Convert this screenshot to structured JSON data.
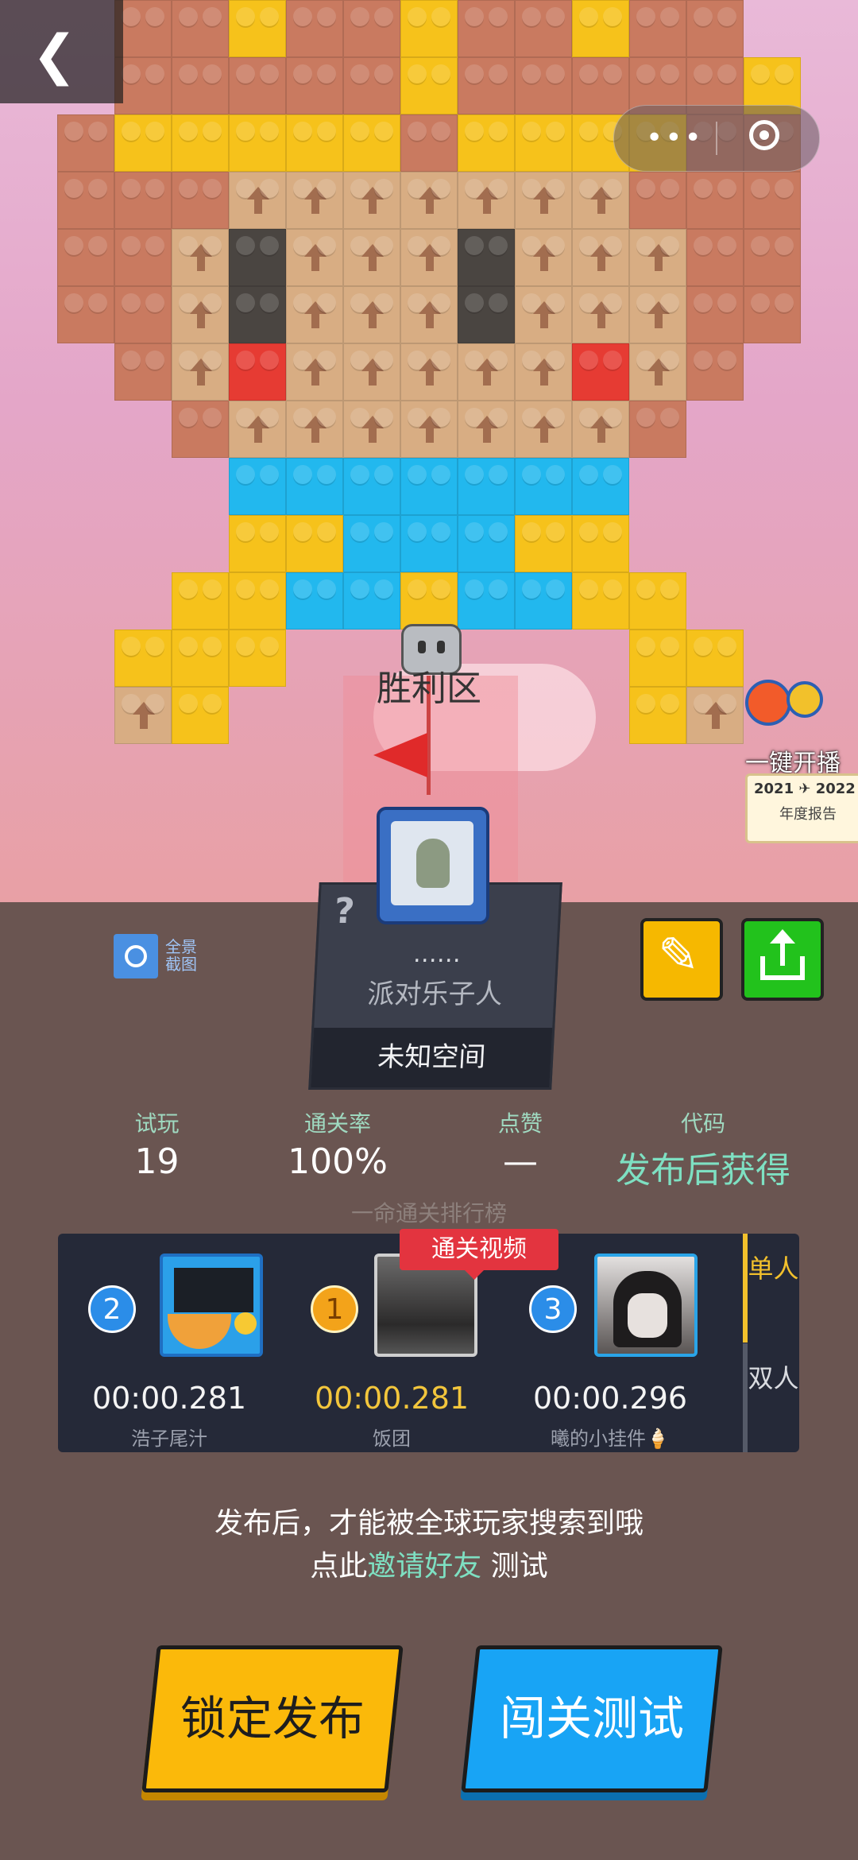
{
  "header": {
    "back_icon": "chevron-left-icon",
    "capsule_more_icon": "more-dots-icon",
    "capsule_close_icon": "target-close-icon"
  },
  "scene": {
    "victory_label": "胜利区",
    "colors": {
      "salmon": "#c97a60",
      "yellow": "#f6c21b",
      "tan": "#d8ad83",
      "dark": "#4a4541",
      "red": "#e63b33",
      "blue": "#22b8ee"
    }
  },
  "promo": {
    "label": "一键开播",
    "years": "2021 ✈ 2022",
    "subtitle": "年度报告"
  },
  "level_card": {
    "question_mark": "?",
    "ellipsis": "……",
    "author": "派对乐子人",
    "space_name": "未知空间"
  },
  "tools": {
    "screenshot_label": "全景截图",
    "edit_icon": "pencil-icon",
    "share_icon": "share-upload-icon"
  },
  "stats": [
    {
      "label": "试玩",
      "value": "19"
    },
    {
      "label": "通关率",
      "value": "100%"
    },
    {
      "label": "点赞",
      "value": "—"
    },
    {
      "label": "代码",
      "value": "发布后获得"
    }
  ],
  "leaderboard": {
    "caption": "一命通关排行榜",
    "video_tag": "通关视频",
    "entries": [
      {
        "rank": "2",
        "time": "00:00.281",
        "name": "浩子尾汁"
      },
      {
        "rank": "1",
        "time": "00:00.281",
        "name": "饭团"
      },
      {
        "rank": "3",
        "time": "00:00.296",
        "name": "曦的小挂件🍦"
      }
    ],
    "tabs": [
      {
        "label": "单人"
      },
      {
        "label": "双人"
      }
    ]
  },
  "hint": {
    "line1": "发布后，才能被全球玩家搜索到哦",
    "line2_prefix": "点此",
    "line2_link": "邀请好友",
    "line2_suffix": "测试"
  },
  "actions": {
    "publish_label": "锁定发布",
    "test_label": "闯关测试"
  }
}
